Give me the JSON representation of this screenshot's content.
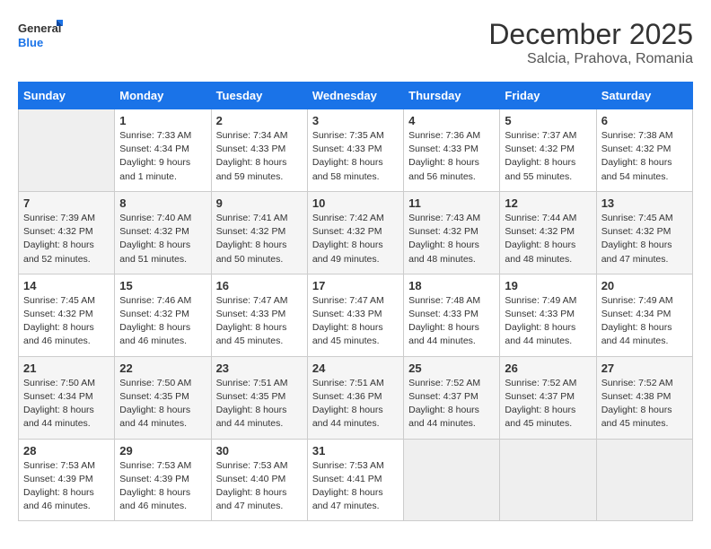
{
  "logo": {
    "line1": "General",
    "line2": "Blue"
  },
  "title": "December 2025",
  "location": "Salcia, Prahova, Romania",
  "days_header": [
    "Sunday",
    "Monday",
    "Tuesday",
    "Wednesday",
    "Thursday",
    "Friday",
    "Saturday"
  ],
  "weeks": [
    [
      {
        "num": "",
        "info": ""
      },
      {
        "num": "1",
        "info": "Sunrise: 7:33 AM\nSunset: 4:34 PM\nDaylight: 9 hours\nand 1 minute."
      },
      {
        "num": "2",
        "info": "Sunrise: 7:34 AM\nSunset: 4:33 PM\nDaylight: 8 hours\nand 59 minutes."
      },
      {
        "num": "3",
        "info": "Sunrise: 7:35 AM\nSunset: 4:33 PM\nDaylight: 8 hours\nand 58 minutes."
      },
      {
        "num": "4",
        "info": "Sunrise: 7:36 AM\nSunset: 4:33 PM\nDaylight: 8 hours\nand 56 minutes."
      },
      {
        "num": "5",
        "info": "Sunrise: 7:37 AM\nSunset: 4:32 PM\nDaylight: 8 hours\nand 55 minutes."
      },
      {
        "num": "6",
        "info": "Sunrise: 7:38 AM\nSunset: 4:32 PM\nDaylight: 8 hours\nand 54 minutes."
      }
    ],
    [
      {
        "num": "7",
        "info": "Sunrise: 7:39 AM\nSunset: 4:32 PM\nDaylight: 8 hours\nand 52 minutes."
      },
      {
        "num": "8",
        "info": "Sunrise: 7:40 AM\nSunset: 4:32 PM\nDaylight: 8 hours\nand 51 minutes."
      },
      {
        "num": "9",
        "info": "Sunrise: 7:41 AM\nSunset: 4:32 PM\nDaylight: 8 hours\nand 50 minutes."
      },
      {
        "num": "10",
        "info": "Sunrise: 7:42 AM\nSunset: 4:32 PM\nDaylight: 8 hours\nand 49 minutes."
      },
      {
        "num": "11",
        "info": "Sunrise: 7:43 AM\nSunset: 4:32 PM\nDaylight: 8 hours\nand 48 minutes."
      },
      {
        "num": "12",
        "info": "Sunrise: 7:44 AM\nSunset: 4:32 PM\nDaylight: 8 hours\nand 48 minutes."
      },
      {
        "num": "13",
        "info": "Sunrise: 7:45 AM\nSunset: 4:32 PM\nDaylight: 8 hours\nand 47 minutes."
      }
    ],
    [
      {
        "num": "14",
        "info": "Sunrise: 7:45 AM\nSunset: 4:32 PM\nDaylight: 8 hours\nand 46 minutes."
      },
      {
        "num": "15",
        "info": "Sunrise: 7:46 AM\nSunset: 4:32 PM\nDaylight: 8 hours\nand 46 minutes."
      },
      {
        "num": "16",
        "info": "Sunrise: 7:47 AM\nSunset: 4:33 PM\nDaylight: 8 hours\nand 45 minutes."
      },
      {
        "num": "17",
        "info": "Sunrise: 7:47 AM\nSunset: 4:33 PM\nDaylight: 8 hours\nand 45 minutes."
      },
      {
        "num": "18",
        "info": "Sunrise: 7:48 AM\nSunset: 4:33 PM\nDaylight: 8 hours\nand 44 minutes."
      },
      {
        "num": "19",
        "info": "Sunrise: 7:49 AM\nSunset: 4:33 PM\nDaylight: 8 hours\nand 44 minutes."
      },
      {
        "num": "20",
        "info": "Sunrise: 7:49 AM\nSunset: 4:34 PM\nDaylight: 8 hours\nand 44 minutes."
      }
    ],
    [
      {
        "num": "21",
        "info": "Sunrise: 7:50 AM\nSunset: 4:34 PM\nDaylight: 8 hours\nand 44 minutes."
      },
      {
        "num": "22",
        "info": "Sunrise: 7:50 AM\nSunset: 4:35 PM\nDaylight: 8 hours\nand 44 minutes."
      },
      {
        "num": "23",
        "info": "Sunrise: 7:51 AM\nSunset: 4:35 PM\nDaylight: 8 hours\nand 44 minutes."
      },
      {
        "num": "24",
        "info": "Sunrise: 7:51 AM\nSunset: 4:36 PM\nDaylight: 8 hours\nand 44 minutes."
      },
      {
        "num": "25",
        "info": "Sunrise: 7:52 AM\nSunset: 4:37 PM\nDaylight: 8 hours\nand 44 minutes."
      },
      {
        "num": "26",
        "info": "Sunrise: 7:52 AM\nSunset: 4:37 PM\nDaylight: 8 hours\nand 45 minutes."
      },
      {
        "num": "27",
        "info": "Sunrise: 7:52 AM\nSunset: 4:38 PM\nDaylight: 8 hours\nand 45 minutes."
      }
    ],
    [
      {
        "num": "28",
        "info": "Sunrise: 7:53 AM\nSunset: 4:39 PM\nDaylight: 8 hours\nand 46 minutes."
      },
      {
        "num": "29",
        "info": "Sunrise: 7:53 AM\nSunset: 4:39 PM\nDaylight: 8 hours\nand 46 minutes."
      },
      {
        "num": "30",
        "info": "Sunrise: 7:53 AM\nSunset: 4:40 PM\nDaylight: 8 hours\nand 47 minutes."
      },
      {
        "num": "31",
        "info": "Sunrise: 7:53 AM\nSunset: 4:41 PM\nDaylight: 8 hours\nand 47 minutes."
      },
      {
        "num": "",
        "info": ""
      },
      {
        "num": "",
        "info": ""
      },
      {
        "num": "",
        "info": ""
      }
    ]
  ]
}
